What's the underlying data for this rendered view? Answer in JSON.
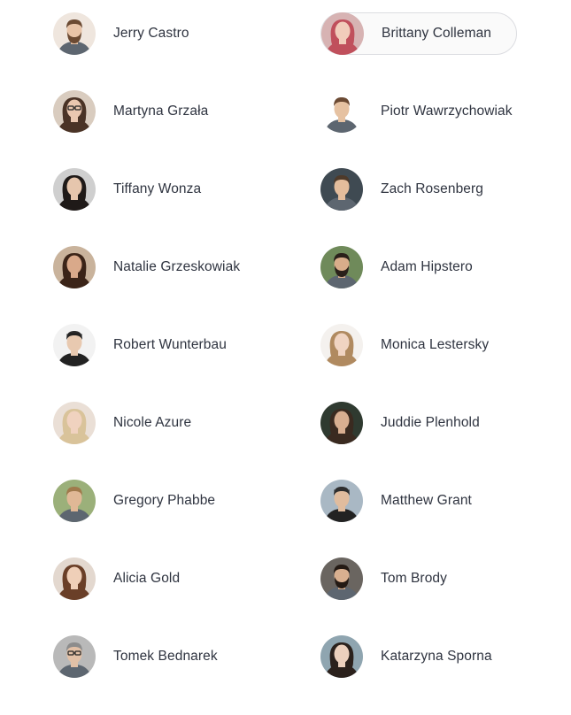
{
  "people": {
    "left": [
      {
        "name": "Jerry Castro",
        "avatar_icon": "avatar-man-beard",
        "skin": "#e8c4a8",
        "hair": "#6b4a33",
        "bg": "#efe6de"
      },
      {
        "name": "Martyna Grzała",
        "avatar_icon": "avatar-woman-glasses",
        "skin": "#eac7b0",
        "hair": "#4a3326",
        "bg": "#d9ccbf"
      },
      {
        "name": "Tiffany Wonza",
        "avatar_icon": "avatar-woman-dark-hair",
        "skin": "#e6c6ad",
        "hair": "#1f1a18",
        "bg": "#cfcfcf"
      },
      {
        "name": "Natalie Grzeskowiak",
        "avatar_icon": "avatar-woman-curly",
        "skin": "#d9a98a",
        "hair": "#3b2418",
        "bg": "#c9b39c"
      },
      {
        "name": "Robert Wunterbau",
        "avatar_icon": "avatar-man-hoodie",
        "skin": "#e8c9b0",
        "hair": "#222222",
        "bg": "#f2f2f2"
      },
      {
        "name": "Nicole Azure",
        "avatar_icon": "avatar-woman-blonde",
        "skin": "#f0d2bf",
        "hair": "#d9c39a",
        "bg": "#eadfd6"
      },
      {
        "name": "Gregory Phabbe",
        "avatar_icon": "avatar-man-outdoor",
        "skin": "#e0b896",
        "hair": "#a07a4c",
        "bg": "#9bb07a"
      },
      {
        "name": "Alicia Gold",
        "avatar_icon": "avatar-woman-brown-hair",
        "skin": "#efcfb8",
        "hair": "#6a3f28",
        "bg": "#e3d8cf"
      },
      {
        "name": "Tomek Bednarek",
        "avatar_icon": "avatar-man-glasses",
        "skin": "#e2c0a6",
        "hair": "#8c8c8c",
        "bg": "#b9b9b9"
      }
    ],
    "right": [
      {
        "name": "Brittany Colleman",
        "avatar_icon": "avatar-woman-red-hair",
        "skin": "#f1cdbb",
        "hair": "#c0505c",
        "bg": "#d7b3b3",
        "selected": true
      },
      {
        "name": "Piotr Wawrzychowiak",
        "avatar_icon": "avatar-man-mint-shirt",
        "skin": "#e6c2a2",
        "hair": "#6b4a33",
        "bg": "#ffffff"
      },
      {
        "name": "Zach Rosenberg",
        "avatar_icon": "avatar-man-blonde",
        "skin": "#e4bd9c",
        "hair": "#4e3a2a",
        "bg": "#3f4a52"
      },
      {
        "name": "Adam Hipstero",
        "avatar_icon": "avatar-man-big-beard",
        "skin": "#d8ad8a",
        "hair": "#2a201a",
        "bg": "#6f8a5a"
      },
      {
        "name": "Monica Lestersky",
        "avatar_icon": "avatar-woman-light",
        "skin": "#f0d4c2",
        "hair": "#b08a60",
        "bg": "#f4f1ee"
      },
      {
        "name": "Juddie Plenhold",
        "avatar_icon": "avatar-woman-dark",
        "skin": "#d8ae90",
        "hair": "#3a2a20",
        "bg": "#2f3a30"
      },
      {
        "name": "Matthew Grant",
        "avatar_icon": "avatar-man-beanie",
        "skin": "#e0bc9e",
        "hair": "#2e2e2e",
        "bg": "#a9b8c4"
      },
      {
        "name": "Tom Brody",
        "avatar_icon": "avatar-man-dark-beard",
        "skin": "#d9b090",
        "hair": "#241a14",
        "bg": "#6a6560"
      },
      {
        "name": "Katarzyna Sporna",
        "avatar_icon": "avatar-woman-long-hair",
        "skin": "#ecd0bd",
        "hair": "#2b211c",
        "bg": "#8fa5b0"
      }
    ]
  }
}
